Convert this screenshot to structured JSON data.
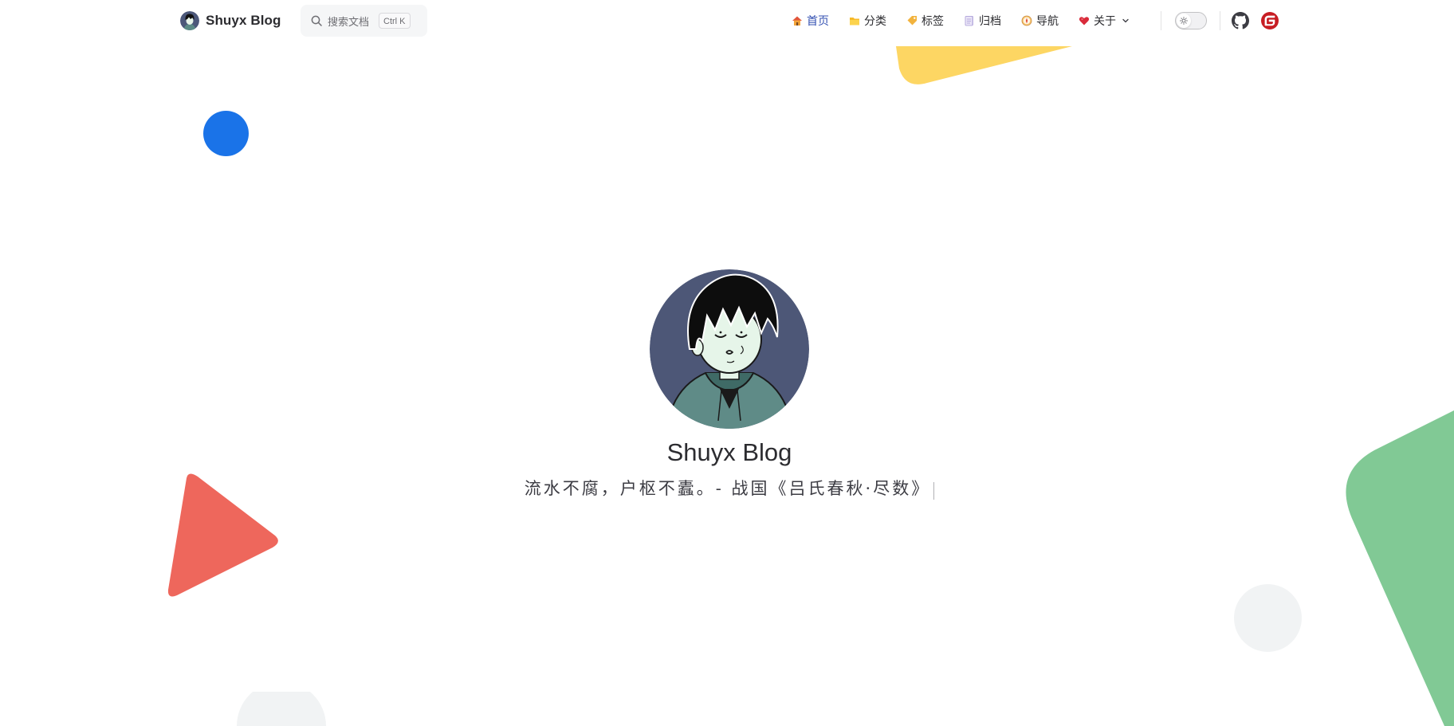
{
  "header": {
    "brand_title": "Shuyx Blog",
    "search_placeholder": "搜索文档",
    "search_shortcut": "Ctrl K",
    "nav": [
      {
        "label": "首页",
        "icon": "home-icon",
        "active": true
      },
      {
        "label": "分类",
        "icon": "folder-icon",
        "active": false
      },
      {
        "label": "标签",
        "icon": "tag-icon",
        "active": false
      },
      {
        "label": "归档",
        "icon": "archive-icon",
        "active": false
      },
      {
        "label": "导航",
        "icon": "compass-icon",
        "active": false
      },
      {
        "label": "关于",
        "icon": "heart-icon",
        "active": false,
        "dropdown": true
      }
    ],
    "social": [
      "github-icon",
      "gitee-icon"
    ]
  },
  "hero": {
    "title": "Shuyx Blog",
    "motto": "流水不腐，户枢不蠹。- 战国《吕氏春秋·尽数》"
  },
  "colors": {
    "accent": "#3451b2",
    "blue_circle": "#1a73e8",
    "red_triangle": "#ee675c",
    "yellow_shape": "#fdd663",
    "green_shape": "#81c995",
    "gray_circle": "#f1f3f4",
    "gitee_red": "#c71d23"
  }
}
